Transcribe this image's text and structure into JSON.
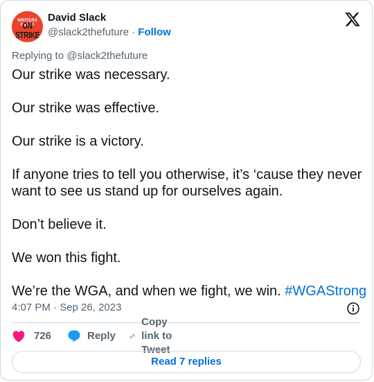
{
  "author": {
    "display_name": "David Slack",
    "handle": "@slack2thefuture",
    "separator": "·",
    "follow_label": "Follow",
    "avatar_text_top": "WRITERS GUILD",
    "avatar_text_bottom": "ON STRIKE",
    "avatar_color": "#e9432c"
  },
  "platform_logo": "x-logo-icon",
  "replying_to": "Replying to @slack2thefuture",
  "tweet": {
    "paragraphs": [
      "Our strike was necessary.",
      "Our strike was effective.",
      "Our strike is a victory.",
      "If anyone tries to tell you otherwise, it’s ‘cause they never want to see us stand up for ourselves again.",
      "Don’t believe it.",
      "We won this fight."
    ],
    "last_paragraph": "We’re the WGA, and when we fight, we win.",
    "hashtag": "#WGAStrong",
    "timestamp": "4:07 PM · Sep 26, 2023"
  },
  "actions": {
    "like_count": "726",
    "reply_label": "Reply",
    "copy_link_label": "Copy link to Tweet"
  },
  "read_replies_label": "Read 7 replies",
  "colors": {
    "link": "#006fd6",
    "like_heart": "#f91880",
    "reply_bubble": "#1d9bf0",
    "muted": "#536471",
    "border": "#cfd9de"
  }
}
